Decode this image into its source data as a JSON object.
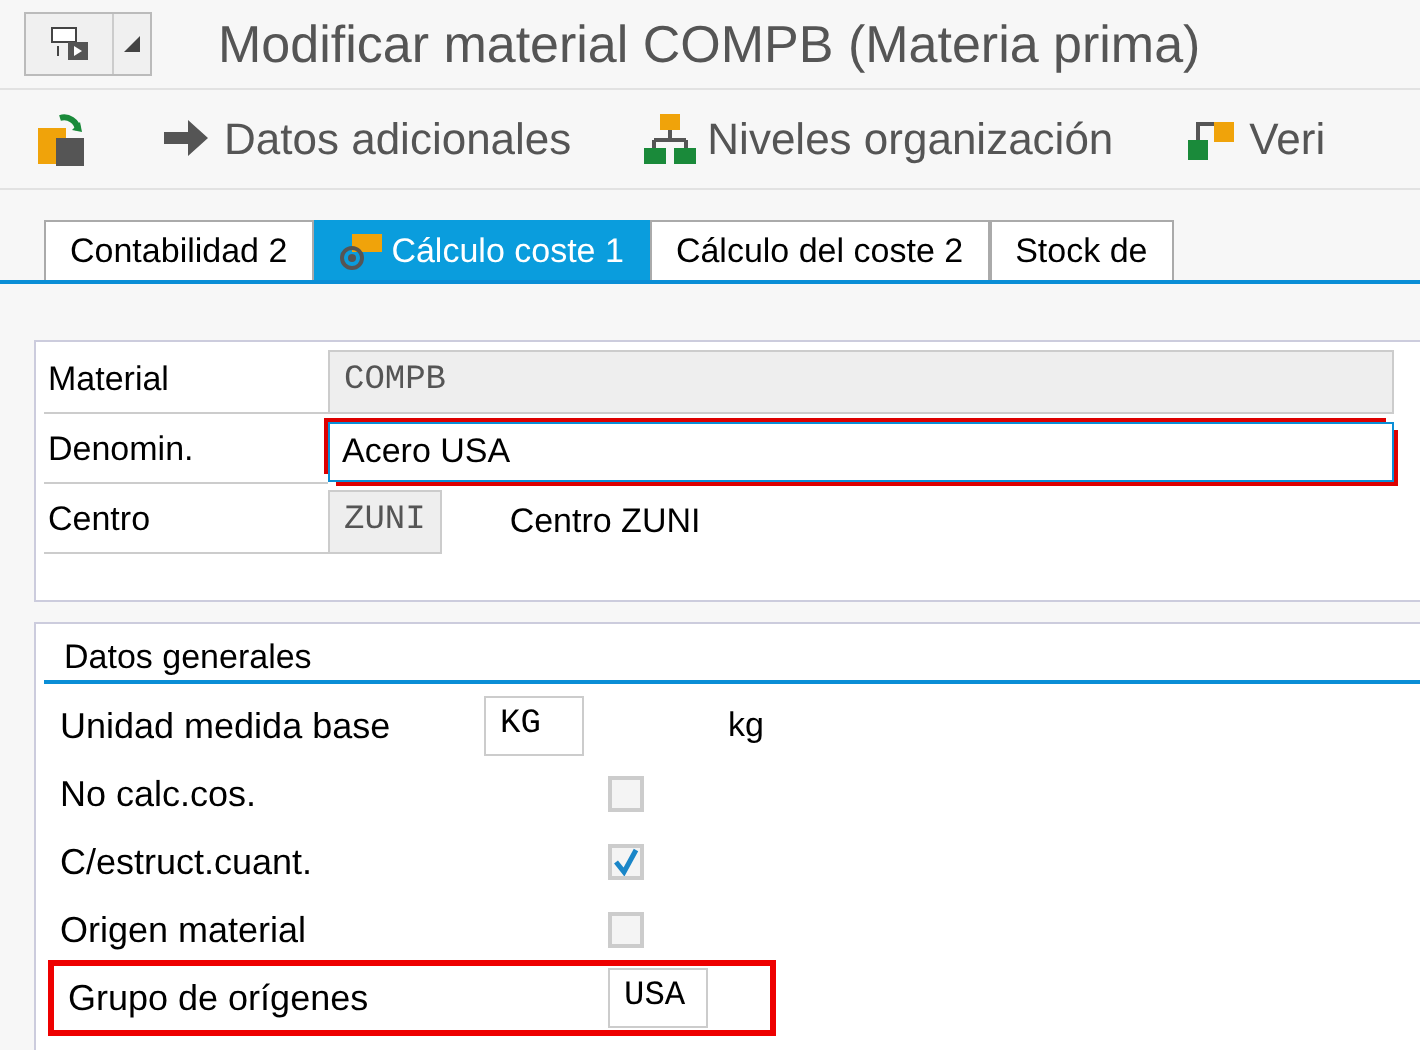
{
  "window": {
    "title": "Modificar material COMPB (Materia prima)"
  },
  "toolbar": [
    {
      "kind": "icon"
    },
    {
      "kind": "button",
      "label": "Datos adicionales"
    },
    {
      "kind": "button",
      "label": "Niveles organización"
    },
    {
      "kind": "button",
      "label": "Veri"
    }
  ],
  "tabs": [
    {
      "label": "Contabilidad 2",
      "selected": false
    },
    {
      "label": "Cálculo coste 1",
      "selected": true
    },
    {
      "label": "Cálculo del coste 2",
      "selected": false
    },
    {
      "label": "Stock de",
      "selected": false
    }
  ],
  "header": [
    {
      "label": "Material",
      "kind": "readonly",
      "value": "COMPB"
    },
    {
      "label": "Denomin.",
      "kind": "input",
      "value": "Acero USA"
    },
    {
      "label": "Centro",
      "kind": "short",
      "value": "ZUNI",
      "description": "Centro ZUNI"
    }
  ],
  "section": {
    "title": "Datos generales",
    "rows": [
      {
        "label": "Unidad medida base",
        "kind": "field",
        "value": "KG",
        "description": "kg",
        "highlighted": false
      },
      {
        "label": "No calc.cos.",
        "kind": "checkbox",
        "checked": false,
        "highlighted": false
      },
      {
        "label": "C/estruct.cuant.",
        "kind": "checkbox",
        "checked": true,
        "highlighted": false
      },
      {
        "label": "Origen material",
        "kind": "checkbox",
        "checked": false,
        "highlighted": false
      },
      {
        "label": "Grupo de orígenes",
        "kind": "field",
        "value": "USA",
        "highlighted": true
      }
    ]
  }
}
